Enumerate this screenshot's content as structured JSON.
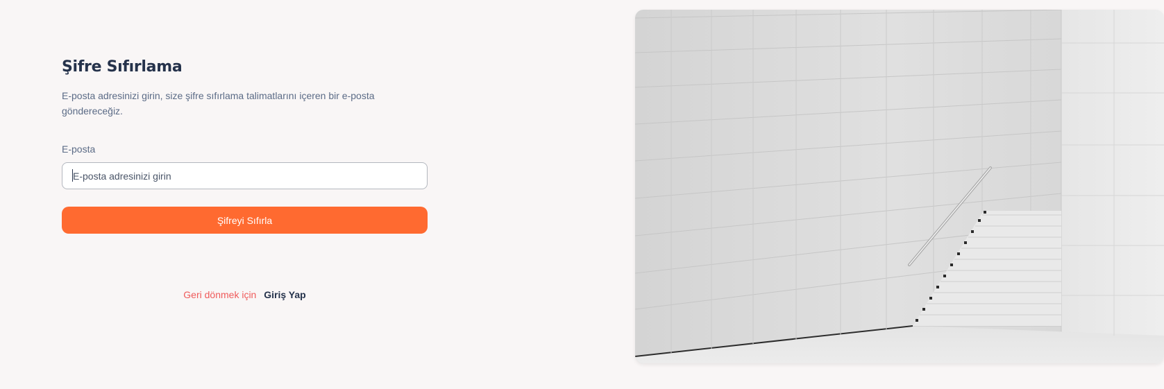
{
  "reset_form": {
    "title": "Şifre Sıfırlama",
    "description": "E-posta adresinizi girin, size şifre sıfırlama talimatlarını içeren bir e-posta göndereceğiz.",
    "email_label": "E-posta",
    "email_placeholder": "E-posta adresinizi girin",
    "email_value": "",
    "submit_label": "Şifreyi Sıfırla",
    "back_text": "Geri dönmek için",
    "login_link": "Giriş Yap"
  },
  "colors": {
    "accent": "#ff6a30",
    "heading": "#25324b",
    "muted": "#5b6b86",
    "back_text": "#ef5a5a",
    "background": "#f9f6f6"
  },
  "illustration": {
    "kind": "photo",
    "subject": "concrete-staircase-with-handrail"
  }
}
